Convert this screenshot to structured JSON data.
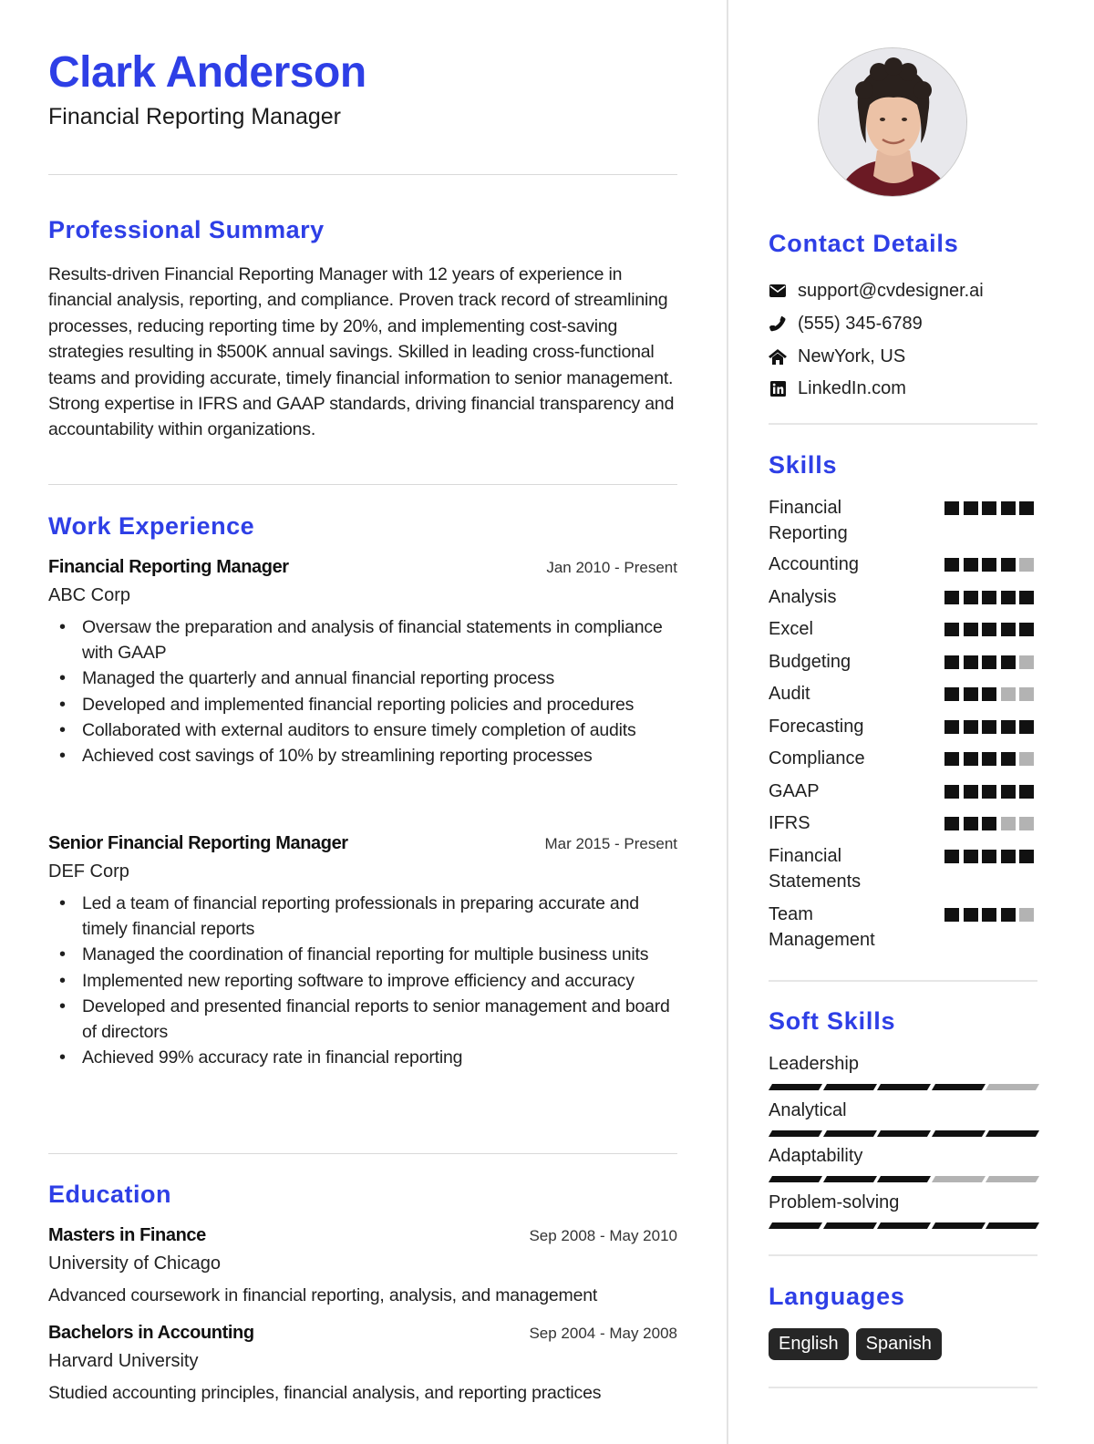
{
  "header": {
    "name": "Clark Anderson",
    "title": "Financial Reporting Manager"
  },
  "summary": {
    "heading": "Professional Summary",
    "text": "Results-driven Financial Reporting Manager with 12 years of experience in financial analysis, reporting, and compliance. Proven track record of streamlining processes, reducing reporting time by 20%, and implementing cost-saving strategies resulting in $500K annual savings. Skilled in leading cross-functional teams and providing accurate, timely financial information to senior management. Strong expertise in IFRS and GAAP standards, driving financial transparency and accountability within organizations."
  },
  "experience": {
    "heading": "Work Experience",
    "jobs": [
      {
        "title": "Financial Reporting Manager",
        "date": "Jan 2010 - Present",
        "company": "ABC Corp",
        "bullets": [
          "Oversaw the preparation and analysis of financial statements in compliance with GAAP",
          "Managed the quarterly and annual financial reporting process",
          "Developed and implemented financial reporting policies and procedures",
          "Collaborated with external auditors to ensure timely completion of audits",
          "Achieved cost savings of 10% by streamlining reporting processes"
        ]
      },
      {
        "title": "Senior Financial Reporting Manager",
        "date": "Mar 2015 - Present",
        "company": "DEF Corp",
        "bullets": [
          "Led a team of financial reporting professionals in preparing accurate and timely financial reports",
          "Managed the coordination of financial reporting for multiple business units",
          "Implemented new reporting software to improve efficiency and accuracy",
          "Developed and presented financial reports to senior management and board of directors",
          "Achieved 99% accuracy rate in financial reporting"
        ]
      }
    ]
  },
  "education": {
    "heading": "Education",
    "items": [
      {
        "degree": "Masters in Finance",
        "date": "Sep 2008 - May 2010",
        "school": "University of Chicago",
        "description": "Advanced coursework in financial reporting, analysis, and management"
      },
      {
        "degree": "Bachelors in Accounting",
        "date": "Sep 2004 - May 2008",
        "school": "Harvard University",
        "description": "Studied accounting principles, financial analysis, and reporting practices"
      }
    ]
  },
  "contact": {
    "heading": "Contact Details",
    "items": [
      {
        "icon": "envelope-icon",
        "text": "support@cvdesigner.ai"
      },
      {
        "icon": "phone-icon",
        "text": "(555) 345-6789"
      },
      {
        "icon": "home-icon",
        "text": "NewYork, US"
      },
      {
        "icon": "linkedin-icon",
        "text": "LinkedIn.com"
      }
    ]
  },
  "skills": {
    "heading": "Skills",
    "max": 5,
    "items": [
      {
        "name": "Financial Reporting",
        "level": 5
      },
      {
        "name": "Accounting",
        "level": 4
      },
      {
        "name": "Analysis",
        "level": 5
      },
      {
        "name": "Excel",
        "level": 5
      },
      {
        "name": "Budgeting",
        "level": 4
      },
      {
        "name": "Audit",
        "level": 3
      },
      {
        "name": "Forecasting",
        "level": 5
      },
      {
        "name": "Compliance",
        "level": 4
      },
      {
        "name": "GAAP",
        "level": 5
      },
      {
        "name": "IFRS",
        "level": 3
      },
      {
        "name": "Financial Statements",
        "level": 5
      },
      {
        "name": "Team Management",
        "level": 4
      }
    ]
  },
  "soft_skills": {
    "heading": "Soft Skills",
    "max": 5,
    "items": [
      {
        "name": "Leadership",
        "level": 4
      },
      {
        "name": "Analytical",
        "level": 5
      },
      {
        "name": "Adaptability",
        "level": 3
      },
      {
        "name": "Problem-solving",
        "level": 5
      }
    ]
  },
  "languages": {
    "heading": "Languages",
    "items": [
      "English",
      "Spanish"
    ]
  },
  "colors": {
    "accent": "#2e3fe6",
    "filled": "#111111",
    "empty": "#b3b3b3",
    "pill": "#262626"
  }
}
